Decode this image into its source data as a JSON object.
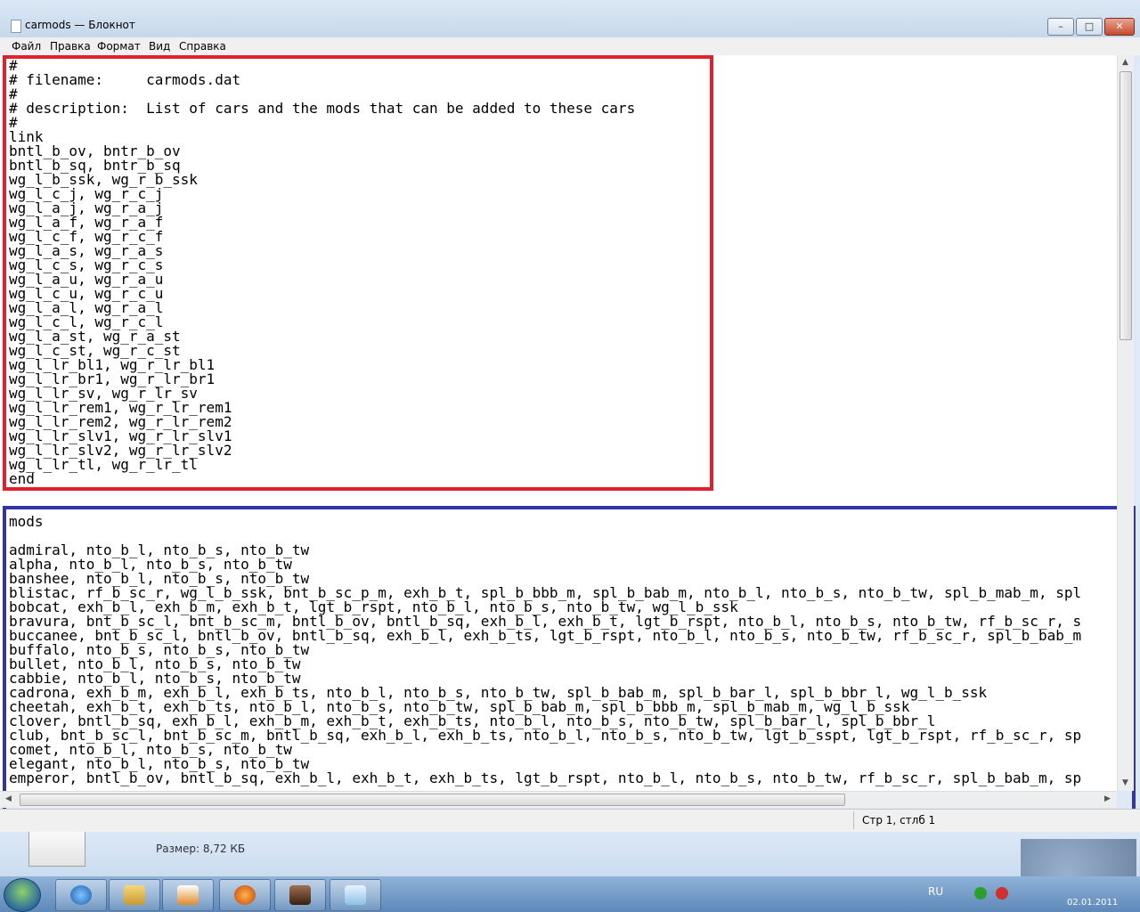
{
  "window": {
    "title": "carmods — Блокнот"
  },
  "menu": [
    "Файл",
    "Правка",
    "Формат",
    "Вид",
    "Справка"
  ],
  "editor_lines": [
    "#",
    "# filename:     carmods.dat",
    "#",
    "# description:  List of cars and the mods that can be added to these cars",
    "#",
    "link",
    "bntl_b_ov, bntr_b_ov",
    "bntl_b_sq, bntr_b_sq",
    "wg_l_b_ssk, wg_r_b_ssk",
    "wg_l_c_j, wg_r_c_j",
    "wg_l_a_j, wg_r_a_j",
    "wg_l_a_f, wg_r_a_f",
    "wg_l_c_f, wg_r_c_f",
    "wg_l_a_s, wg_r_a_s",
    "wg_l_c_s, wg_r_c_s",
    "wg_l_a_u, wg_r_a_u",
    "wg_l_c_u, wg_r_c_u",
    "wg_l_a_l, wg_r_a_l",
    "wg_l_c_l, wg_r_c_l",
    "wg_l_a_st, wg_r_a_st",
    "wg_l_c_st, wg_r_c_st",
    "wg_l_lr_bl1, wg_r_lr_bl1",
    "wg_l_lr_br1, wg_r_lr_br1",
    "wg_l_lr_sv, wg_r_lr_sv",
    "wg_l_lr_rem1, wg_r_lr_rem1",
    "wg_l_lr_rem2, wg_r_lr_rem2",
    "wg_l_lr_slv1, wg_r_lr_slv1",
    "wg_l_lr_slv2, wg_r_lr_slv2",
    "wg_l_lr_tl, wg_r_lr_tl",
    "end",
    "",
    "",
    "mods",
    "",
    "admiral, nto_b_l, nto_b_s, nto_b_tw",
    "alpha, nto_b_l, nto_b_s, nto_b_tw",
    "banshee, nto_b_l, nto_b_s, nto_b_tw",
    "blistac, rf_b_sc_r, wg_l_b_ssk, bnt_b_sc_p_m, exh_b_t, spl_b_bbb_m, spl_b_bab_m, nto_b_l, nto_b_s, nto_b_tw, spl_b_mab_m, spl",
    "bobcat, exh_b_l, exh_b_m, exh_b_t, lgt_b_rspt, nto_b_l, nto_b_s, nto_b_tw, wg_l_b_ssk",
    "bravura, bnt_b_sc_l, bnt_b_sc_m, bntl_b_ov, bntl_b_sq, exh_b_l, exh_b_t, lgt_b_rspt, nto_b_l, nto_b_s, nto_b_tw, rf_b_sc_r, s",
    "buccanee, bnt_b_sc_l, bntl_b_ov, bntl_b_sq, exh_b_l, exh_b_ts, lgt_b_rspt, nto_b_l, nto_b_s, nto_b_tw, rf_b_sc_r, spl_b_bab_m",
    "buffalo, nto_b_s, nto_b_s, nto_b_tw",
    "bullet, nto_b_l, nto_b_s, nto_b_tw",
    "cabbie, nto_b_l, nto_b_s, nto_b_tw",
    "cadrona, exh_b_m, exh_b_l, exh_b_ts, nto_b_l, nto_b_s, nto_b_tw, spl_b_bab_m, spl_b_bar_l, spl_b_bbr_l, wg_l_b_ssk",
    "cheetah, exh_b_t, exh_b_ts, nto_b_l, nto_b_s, nto_b_tw, spl_b_bab_m, spl_b_bbb_m, spl_b_mab_m, wg_l_b_ssk",
    "clover, bntl_b_sq, exh_b_l, exh_b_m, exh_b_t, exh_b_ts, nto_b_l, nto_b_s, nto_b_tw, spl_b_bar_l, spl_b_bbr_l",
    "club, bnt_b_sc_l, bnt_b_sc_m, bntl_b_sq, exh_b_l, exh_b_ts, nto_b_l, nto_b_s, nto_b_tw, lgt_b_sspt, lgt_b_rspt, rf_b_sc_r, sp",
    "comet, nto_b_l, nto_b_s, nto_b_tw",
    "elegant, nto_b_l, nto_b_s, nto_b_tw",
    "emperor, bntl_b_ov, bntl_b_sq, exh_b_l, exh_b_t, exh_b_ts, lgt_b_rspt, nto_b_l, nto_b_s, nto_b_tw, rf_b_sc_r, spl_b_bab_m, sp"
  ],
  "status": {
    "position": "Стр 1, стлб 1"
  },
  "explorer": {
    "size_label": "Размер: 8,72 КБ"
  },
  "tray": {
    "lang": "RU",
    "date": "02.01.2011"
  },
  "colors": {
    "highlight_red": "#e0202a",
    "highlight_blue": "#3333aa"
  }
}
